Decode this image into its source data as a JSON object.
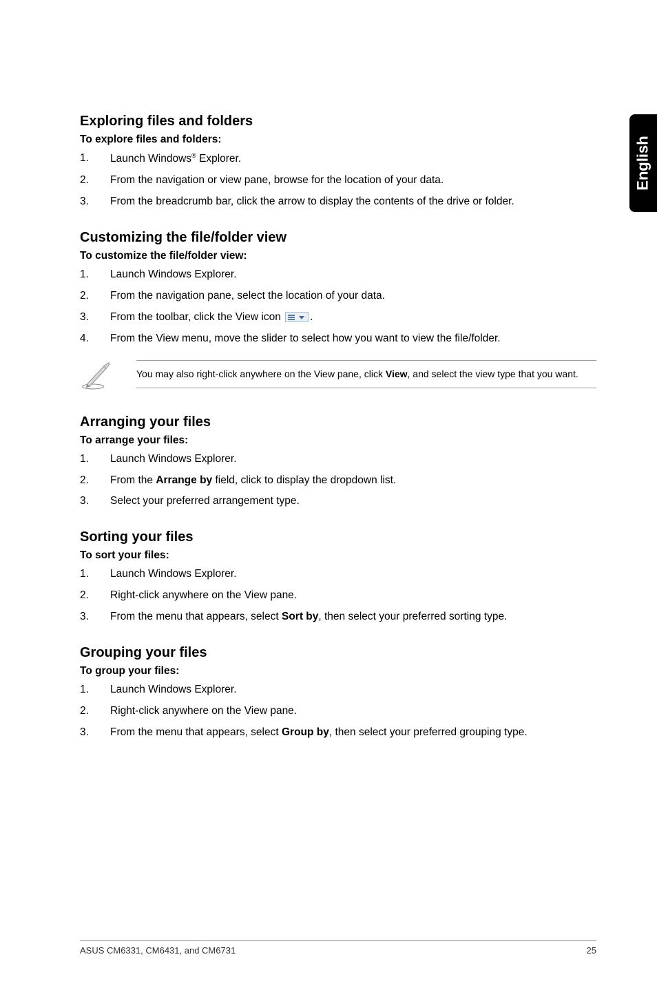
{
  "sideTab": "English",
  "sections": [
    {
      "h2": "Exploring files and folders",
      "h3": "To explore files and folders:",
      "items": [
        {
          "n": "1.",
          "prefix": "Launch Windows",
          "sup": "®",
          "suffix": " Explorer."
        },
        {
          "n": "2.",
          "text": "From the navigation or view pane, browse for the location of your data."
        },
        {
          "n": "3.",
          "text": "From the breadcrumb bar, click the arrow to display the contents of the drive or folder."
        }
      ]
    },
    {
      "h2": "Customizing the file/folder view",
      "h3": "To customize the file/folder view:",
      "items": [
        {
          "n": "1.",
          "text": "Launch Windows Explorer."
        },
        {
          "n": "2.",
          "text": "From the navigation pane, select the location of your data."
        },
        {
          "n": "3.",
          "prefix": "From the toolbar, click the View icon ",
          "hasViewIcon": true,
          "suffix": "."
        },
        {
          "n": "4.",
          "text": "From the View menu, move the slider to select how you want to view the file/folder."
        }
      ],
      "note": {
        "prefix": "You may also right-click anywhere on the View pane, click ",
        "bold": "View",
        "suffix": ", and select the view type that you want."
      }
    },
    {
      "h2": "Arranging your files",
      "h3": "To arrange your files:",
      "items": [
        {
          "n": "1.",
          "text": "Launch Windows Explorer."
        },
        {
          "n": "2.",
          "prefix": "From the ",
          "bold": "Arrange by",
          "suffix": " field, click to display the dropdown list."
        },
        {
          "n": "3.",
          "text": "Select your preferred arrangement type."
        }
      ]
    },
    {
      "h2": "Sorting your files",
      "h3": "To sort your files:",
      "items": [
        {
          "n": "1.",
          "text": "Launch Windows Explorer."
        },
        {
          "n": "2.",
          "text": "Right-click anywhere on the View pane."
        },
        {
          "n": "3.",
          "prefix": "From the menu that appears, select ",
          "bold": "Sort by",
          "suffix": ", then select your preferred sorting type."
        }
      ]
    },
    {
      "h2": "Grouping your files",
      "h3": "To group your files:",
      "items": [
        {
          "n": "1.",
          "text": "Launch Windows Explorer."
        },
        {
          "n": "2.",
          "text": "Right-click anywhere on the View pane."
        },
        {
          "n": "3.",
          "prefix": "From the menu that appears, select ",
          "bold": "Group by",
          "suffix": ", then select your preferred grouping type."
        }
      ]
    }
  ],
  "footer": {
    "left": "ASUS CM6331, CM6431, and CM6731",
    "right": "25"
  }
}
